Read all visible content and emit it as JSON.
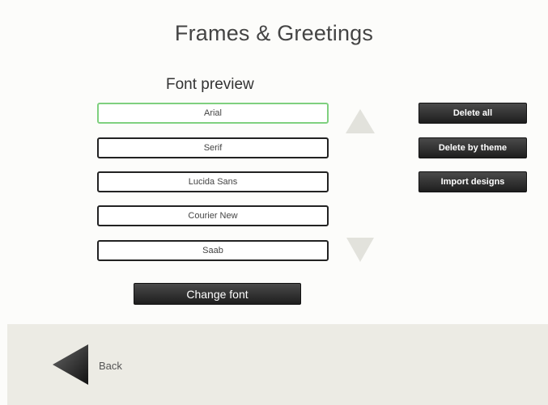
{
  "header": {
    "title": "Frames & Greetings"
  },
  "font_preview": {
    "label": "Font preview",
    "fonts": [
      {
        "name": "Arial",
        "selected": true
      },
      {
        "name": "Serif",
        "selected": false
      },
      {
        "name": "Lucida Sans",
        "selected": false
      },
      {
        "name": "Courier New",
        "selected": false
      },
      {
        "name": "Saab",
        "selected": false
      }
    ],
    "scroll_up_icon": "triangle-up-icon",
    "scroll_down_icon": "triangle-down-icon",
    "change_font_label": "Change font"
  },
  "actions": {
    "delete_all_label": "Delete all",
    "delete_by_theme_label": "Delete by theme",
    "import_designs_label": "Import designs"
  },
  "footer": {
    "back_label": "Back",
    "back_icon": "back-arrow-icon"
  },
  "colors": {
    "selected_border": "#7fd07f",
    "button_bg": "#2e2e2e",
    "footer_bg": "#ecebe4",
    "page_bg": "#fcfcfa"
  }
}
